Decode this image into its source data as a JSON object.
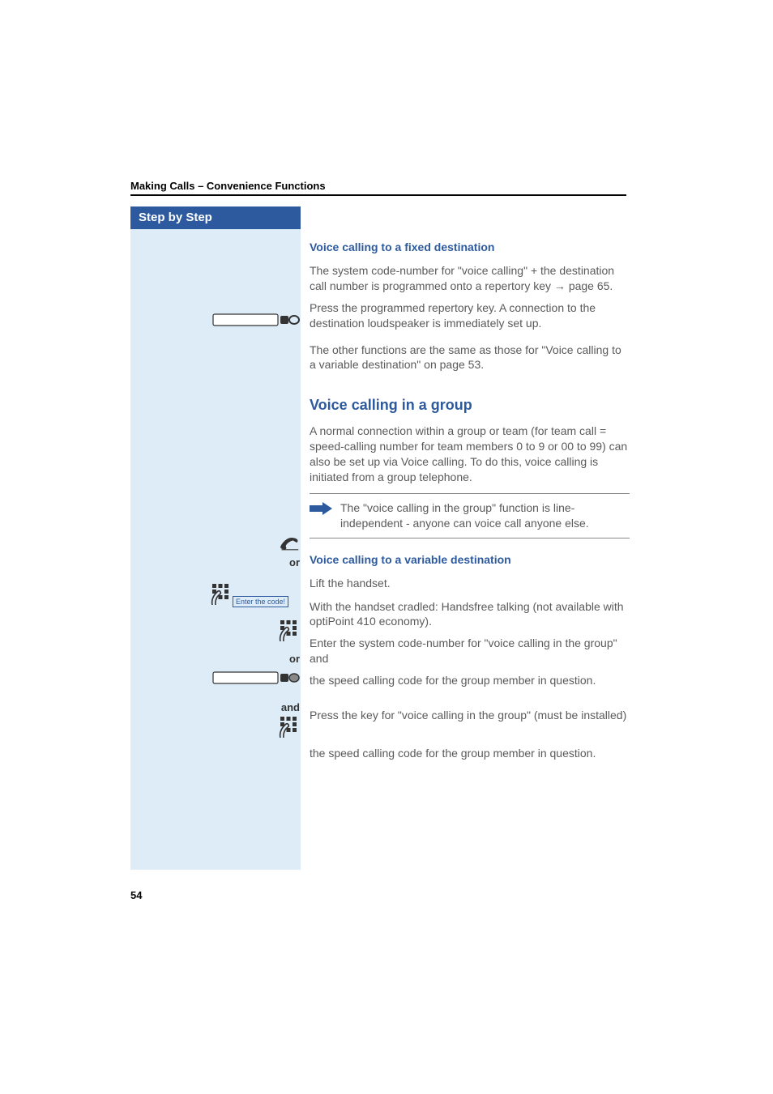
{
  "header": {
    "section_title": "Making Calls – Convenience Functions"
  },
  "sidebar": {
    "title": "Step by Step"
  },
  "content": {
    "h3_fixed": "Voice calling to a fixed destination",
    "para_fixed_1a": "The system code-number for \"voice calling\" + the destination call number is programmed onto a repertory key ",
    "para_fixed_1b": "page 65.",
    "para_fixed_2": "Press the programmed repertory key. A connection to the destination loudspeaker is immediately set up.",
    "para_fixed_3": "The other functions are the same as those for \"Voice calling to a variable destination\" on page 53.",
    "h2_group": "Voice calling in a group",
    "para_group_1": "A normal connection within a group or team (for team call = speed-calling number for team members 0 to 9 or 00 to 99) can also be set up via Voice calling. To do this, voice calling is initiated from a group telephone.",
    "note_text": "The \"voice calling in the group\" function is line-independent - anyone can voice call anyone else.",
    "h3_variable": "Voice calling to a variable destination",
    "step_lift": "Lift the handset.",
    "or1": "or",
    "step_handsfree": "With the handset cradled: Handsfree talking (not available with optiPoint 410 economy).",
    "step_entercode": "Enter the system code-number for \"voice calling in the group\" and",
    "entercode_label": "Enter the code!",
    "step_speed1": "the speed calling code for the group member in question.",
    "or2": "or",
    "step_presskey": "Press the key for \"voice calling in the group\" (must be installed)",
    "and1": "and",
    "step_speed2": "the speed calling code for the group member in question."
  },
  "footer": {
    "page_number": "54"
  }
}
